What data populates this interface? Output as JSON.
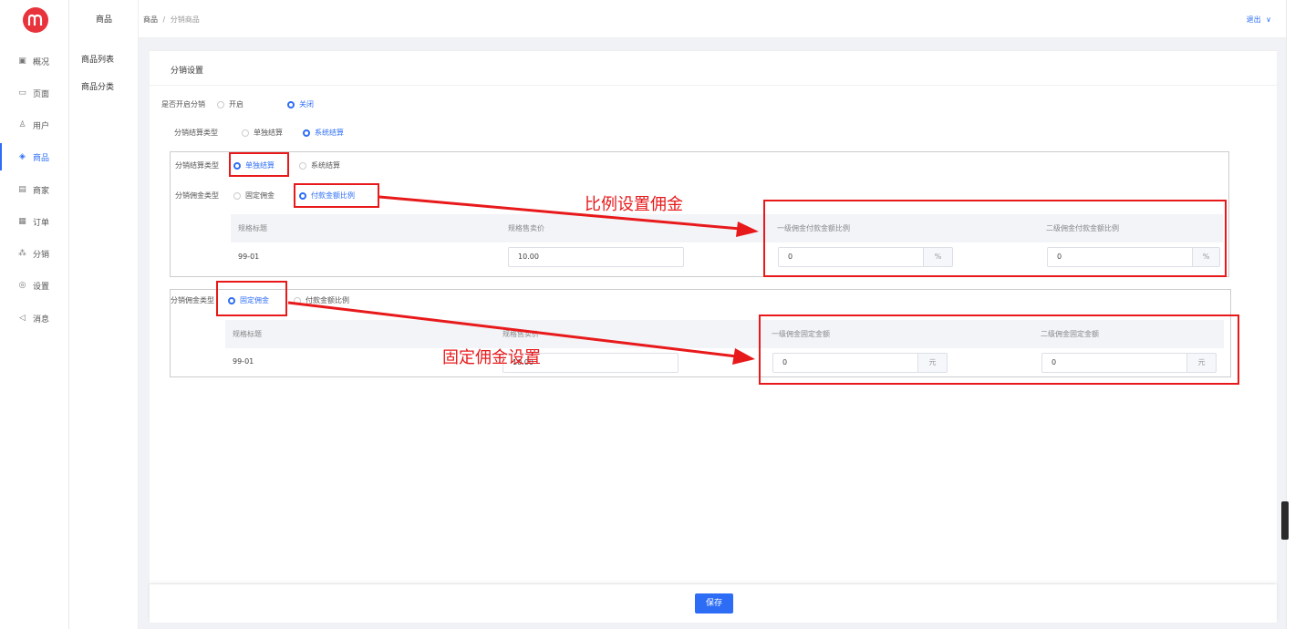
{
  "nav": {
    "items": [
      {
        "label": "概况",
        "icon": "dashboard-icon",
        "glyph": "▣"
      },
      {
        "label": "页面",
        "icon": "page-icon",
        "glyph": "▭"
      },
      {
        "label": "用户",
        "icon": "user-icon",
        "glyph": "♙"
      },
      {
        "label": "商品",
        "icon": "goods-icon",
        "glyph": "◈"
      },
      {
        "label": "商家",
        "icon": "shop-icon",
        "glyph": "▤"
      },
      {
        "label": "订单",
        "icon": "order-icon",
        "glyph": "▦"
      },
      {
        "label": "分销",
        "icon": "distribution-icon",
        "glyph": "⁂"
      },
      {
        "label": "设置",
        "icon": "settings-icon",
        "glyph": "◎"
      },
      {
        "label": "消息",
        "icon": "message-icon",
        "glyph": "◁"
      }
    ],
    "active_index": 3
  },
  "subnav": {
    "title": "商品",
    "items": [
      "商品列表",
      "商品分类"
    ]
  },
  "header": {
    "breadcrumb_root": "商品",
    "breadcrumb_sep": "/",
    "breadcrumb_current": "分销商品",
    "logout": "退出",
    "logout_chevron": "∨"
  },
  "card": {
    "title": "分销设置",
    "enable_label": "是否开启分销",
    "enable_options": [
      "开启",
      "关闭"
    ],
    "enable_selected": 1,
    "settle_label": "分销结算类型",
    "settle_options": [
      "单独结算",
      "系统结算"
    ],
    "settle_selected": 1
  },
  "box1": {
    "settle_label": "分销结算类型",
    "settle_options": [
      "单独结算",
      "系统结算"
    ],
    "settle_selected": 0,
    "commission_label": "分销佣金类型",
    "commission_options": [
      "固定佣金",
      "付款金额比例"
    ],
    "commission_selected": 1,
    "columns": [
      "规格标题",
      "规格售卖价",
      "一级佣金付款金额比例",
      "二级佣金付款金额比例"
    ],
    "row": {
      "title": "99-01",
      "price": "10.00",
      "level1": "0",
      "level2": "0",
      "suffix": "%"
    }
  },
  "box2": {
    "commission_label": "分销佣金类型",
    "commission_options": [
      "固定佣金",
      "付款金额比例"
    ],
    "commission_selected": 0,
    "columns": [
      "规格标题",
      "规格售卖价",
      "一级佣金固定金额",
      "二级佣金固定金额"
    ],
    "row": {
      "title": "99-01",
      "price": "10.00",
      "level1": "0",
      "level2": "0",
      "suffix": "元"
    }
  },
  "annotations": {
    "ratio": "比例设置佣金",
    "fixed": "固定佣金设置",
    "color": "#e8191b"
  },
  "footer": {
    "save": "保存"
  },
  "colors": {
    "accent": "#2d6df6",
    "logo": "#e8323c"
  }
}
